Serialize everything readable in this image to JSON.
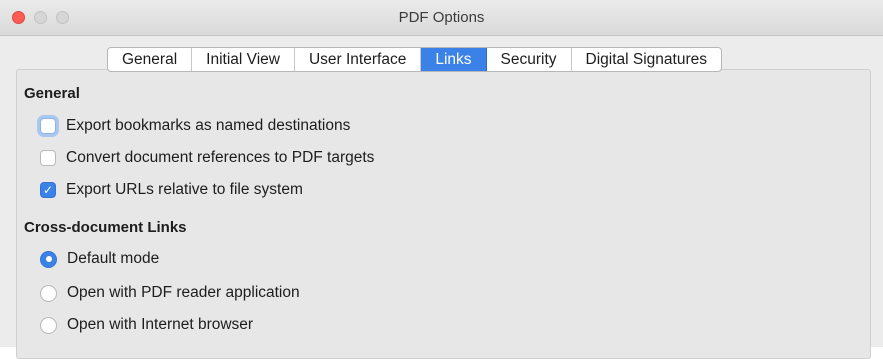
{
  "window": {
    "title": "PDF Options"
  },
  "tabs": [
    {
      "label": "General",
      "active": false
    },
    {
      "label": "Initial View",
      "active": false
    },
    {
      "label": "User Interface",
      "active": false
    },
    {
      "label": "Links",
      "active": true
    },
    {
      "label": "Security",
      "active": false
    },
    {
      "label": "Digital Signatures",
      "active": false
    }
  ],
  "general": {
    "heading": "General",
    "options": [
      {
        "label": "Export bookmarks as named destinations",
        "checked": false,
        "focused": true
      },
      {
        "label": "Convert document references to PDF targets",
        "checked": false
      },
      {
        "label": "Export URLs relative to file system",
        "checked": true
      }
    ]
  },
  "cross_document": {
    "heading": "Cross-document Links",
    "options": [
      {
        "label": "Default mode",
        "selected": true
      },
      {
        "label": "Open with PDF reader application",
        "selected": false
      },
      {
        "label": "Open with Internet browser",
        "selected": false
      }
    ]
  },
  "colors": {
    "accent": "#3b82e8",
    "close_button": "#fd5c55",
    "window_bg": "#ececec"
  },
  "icons": {
    "check": "checkmark-icon"
  }
}
